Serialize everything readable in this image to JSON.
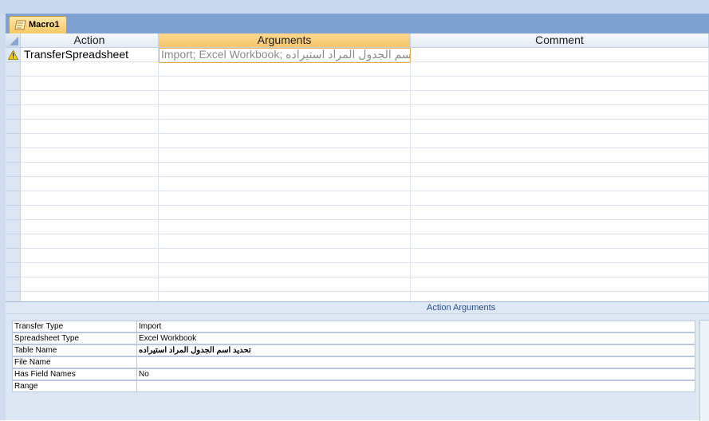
{
  "tab": {
    "title": "Macro1"
  },
  "grid": {
    "headers": {
      "action": "Action",
      "arguments": "Arguments",
      "comment": "Comment"
    },
    "rows": [
      {
        "action": "TransferSpreadsheet",
        "arguments": "Import; Excel Workbook; تحديد اسم الجدول المراد استيراده",
        "comment": "",
        "warning": true
      }
    ]
  },
  "action_arguments": {
    "title": "Action Arguments",
    "fields": [
      {
        "label": "Transfer Type",
        "value": "Import"
      },
      {
        "label": "Spreadsheet Type",
        "value": "Excel Workbook"
      },
      {
        "label": "Table Name",
        "value": "تحديد اسم الجدول المراد استيراده"
      },
      {
        "label": "File Name",
        "value": ""
      },
      {
        "label": "Has Field Names",
        "value": "No"
      },
      {
        "label": "Range",
        "value": ""
      }
    ]
  },
  "icons": {
    "tab": "macro-icon",
    "row_warning": "warning-icon"
  },
  "colors": {
    "tab_accent": "#f8c866",
    "selected_header": "#f7c56a",
    "focus_border": "#f1a944"
  }
}
